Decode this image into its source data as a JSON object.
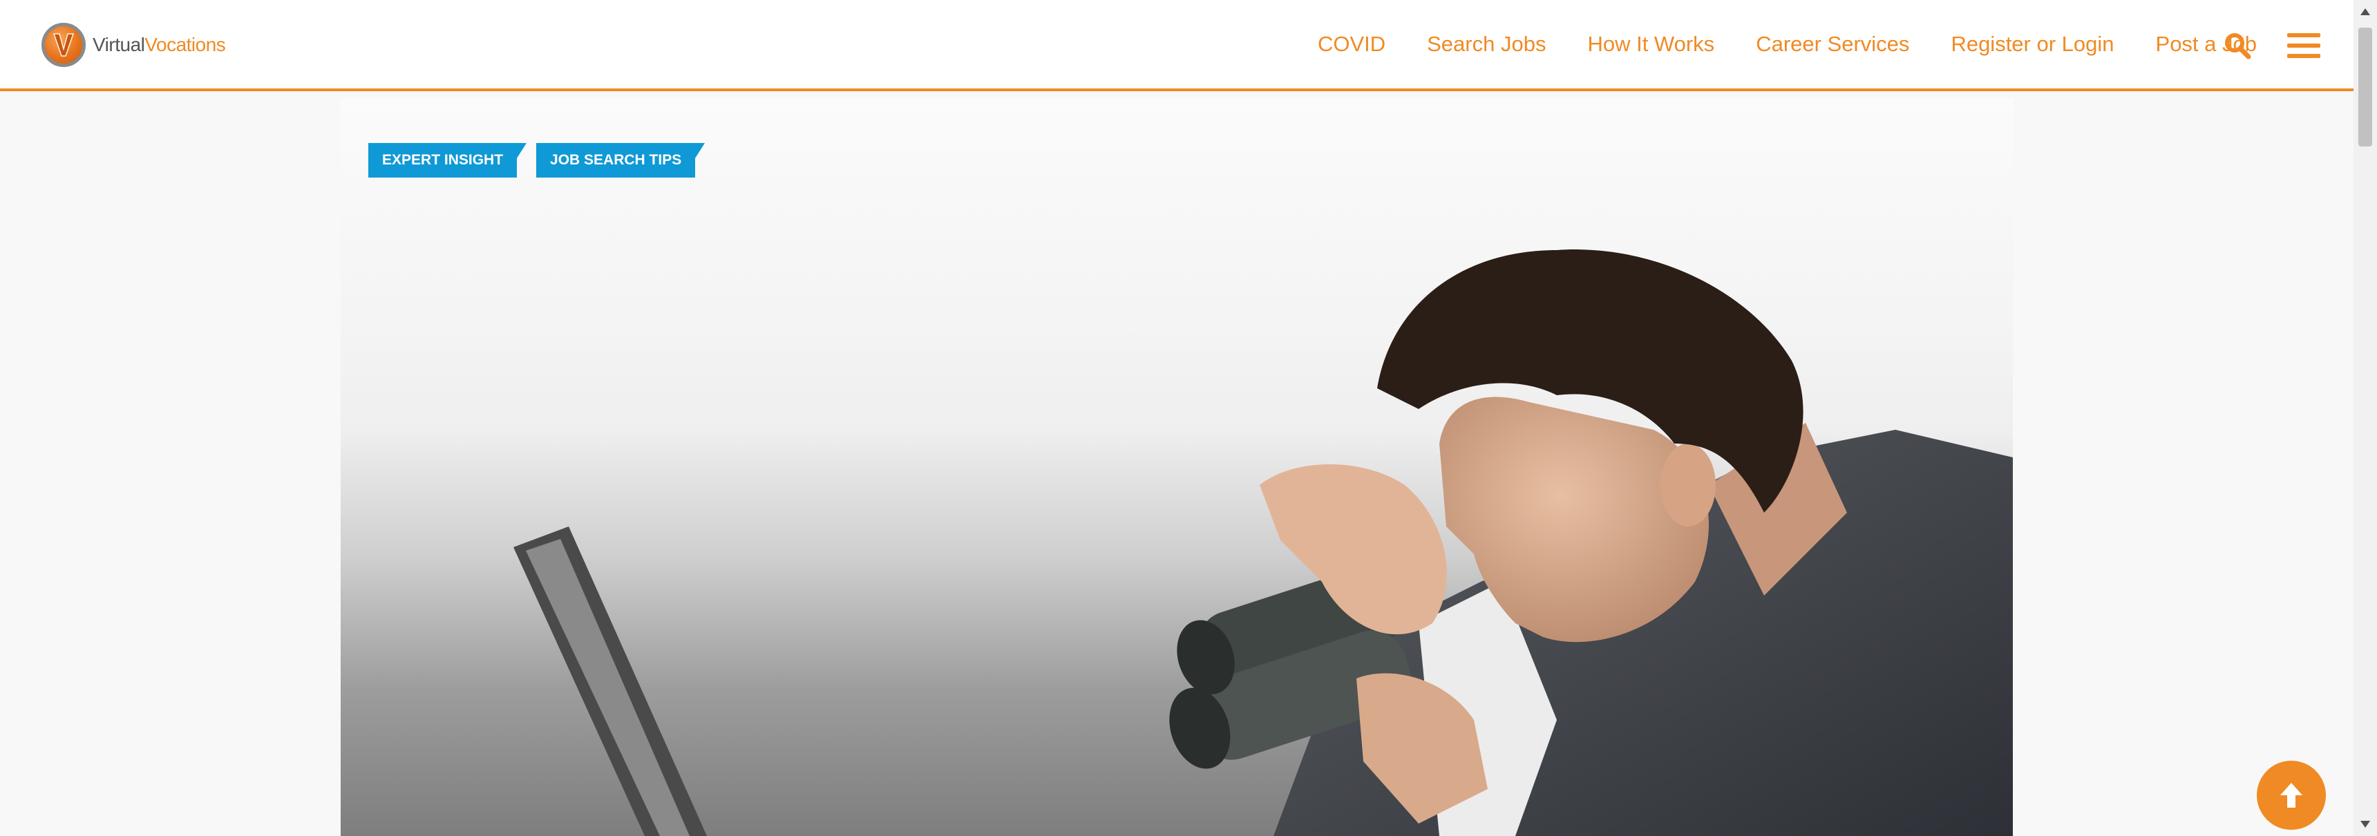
{
  "logo": {
    "letter": "V",
    "text_virtual": "Virtual",
    "text_vocations": "Vocations"
  },
  "nav": {
    "items": [
      {
        "label": "COVID"
      },
      {
        "label": "Search Jobs"
      },
      {
        "label": "How It Works"
      },
      {
        "label": "Career Services"
      },
      {
        "label": "Register or Login"
      },
      {
        "label": "Post a Job"
      }
    ],
    "search_icon": "search-icon",
    "menu_icon": "hamburger-menu-icon"
  },
  "hero": {
    "tags": [
      {
        "label": "EXPERT INSIGHT"
      },
      {
        "label": "JOB SEARCH TIPS"
      }
    ],
    "image": "man-with-binoculars-looking-at-laptop"
  },
  "back_to_top": {
    "icon": "arrow-up-icon"
  },
  "colors": {
    "accent": "#f08a24",
    "tag_bg": "#0f99d6"
  }
}
